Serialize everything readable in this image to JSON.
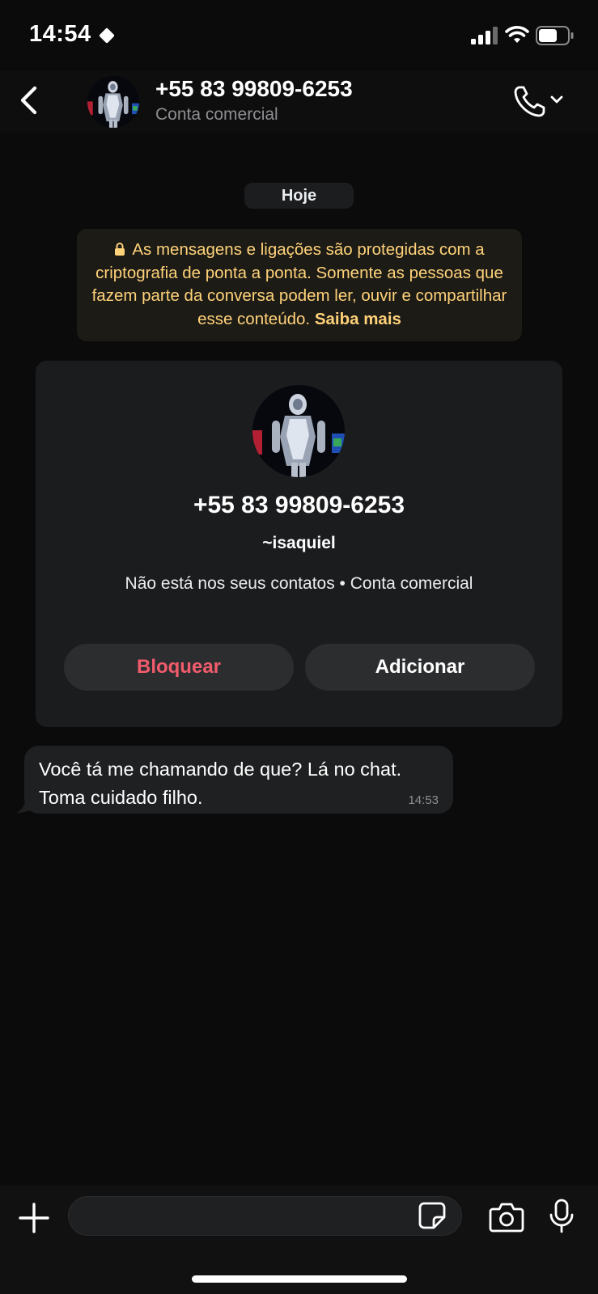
{
  "status_bar": {
    "time": "14:54"
  },
  "header": {
    "title": "+55 83 99809-6253",
    "subtitle": "Conta comercial",
    "icons": {
      "back": "chevron-left-icon",
      "call": "phone-icon",
      "call_menu": "chevron-down-icon"
    }
  },
  "date_label": "Hoje",
  "encryption_notice": {
    "text": "As mensagens e ligações são protegidas com a criptografia de ponta a ponta. Somente as pessoas que fazem parte da conversa podem ler, ouvir e compartilhar esse conteúdo.",
    "link": "Saiba mais",
    "color": "#ffd279"
  },
  "contact_card": {
    "number": "+55 83 99809-6253",
    "name": "~isaquiel",
    "info": "Não está nos seus contatos • Conta comercial",
    "block_label": "Bloquear",
    "add_label": "Adicionar",
    "block_color": "#f15c6d"
  },
  "messages": [
    {
      "text": "Você tá me chamando de que? Lá no chat. Toma cuidado filho.",
      "time": "14:53"
    }
  ],
  "input_bar": {
    "placeholder": ""
  }
}
